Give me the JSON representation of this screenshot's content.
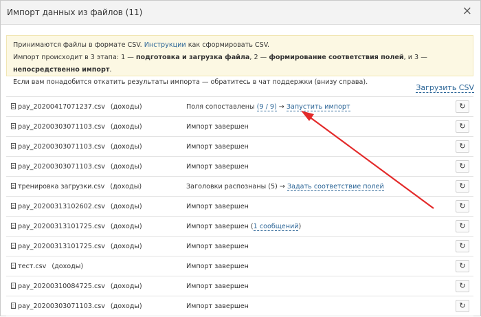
{
  "dialog": {
    "title": "Импорт данных из файлов (11)",
    "close": "×"
  },
  "info": {
    "line1_before": "Принимаются файлы в формате CSV.",
    "line1_link": "Инструкции",
    "line1_after": "как сформировать CSV.",
    "line2_a": "Импорт происходит в 3 этапа: 1 —",
    "line2_b": "подготовка и загрузка файла",
    "line2_c": ", 2 —",
    "line2_d": "формирование соответствия полей",
    "line2_e": ", и 3 —",
    "line2_f": "непосредственно импорт",
    "line2_g": ".",
    "line3": "Если вам понадобится откатить результаты импорта — обратитесь в чат поддержки (внизу справа)."
  },
  "upload_label": "Загрузить CSV",
  "refresh_icon": "refresh-icon",
  "accent_color": "#2a6496",
  "arrow_color": "#e32a2a",
  "rows": [
    {
      "file": "pay_20200417071237.csv",
      "type": "(доходы)",
      "status_text": "Поля сопоставлены",
      "status_link1": "(9 / 9)",
      "status_sep": "→",
      "status_link2": "Запустить импорт",
      "status_after": ""
    },
    {
      "file": "pay_20200303071103.csv",
      "type": "(доходы)",
      "status_text": "Импорт завершен",
      "status_link1": "",
      "status_sep": "",
      "status_link2": "",
      "status_after": ""
    },
    {
      "file": "pay_20200303071103.csv",
      "type": "(доходы)",
      "status_text": "Импорт завершен",
      "status_link1": "",
      "status_sep": "",
      "status_link2": "",
      "status_after": ""
    },
    {
      "file": "pay_20200303071103.csv",
      "type": "(доходы)",
      "status_text": "Импорт завершен",
      "status_link1": "",
      "status_sep": "",
      "status_link2": "",
      "status_after": ""
    },
    {
      "file": "тренировка загрузки.csv",
      "type": "(доходы)",
      "status_text": "Заголовки распознаны (5)",
      "status_link1": "",
      "status_sep": "→",
      "status_link2": "Задать соответствие полей",
      "status_after": ""
    },
    {
      "file": "pay_20200313102602.csv",
      "type": "(доходы)",
      "status_text": "Импорт завершен",
      "status_link1": "",
      "status_sep": "",
      "status_link2": "",
      "status_after": ""
    },
    {
      "file": "pay_20200313101725.csv",
      "type": "(доходы)",
      "status_text": "Импорт завершен (",
      "status_link1": "",
      "status_sep": "",
      "status_link2": "1 сообщений",
      "status_after": ")"
    },
    {
      "file": "pay_20200313101725.csv",
      "type": "(доходы)",
      "status_text": "Импорт завершен",
      "status_link1": "",
      "status_sep": "",
      "status_link2": "",
      "status_after": ""
    },
    {
      "file": "тест.csv",
      "type": "(доходы)",
      "status_text": "Импорт завершен",
      "status_link1": "",
      "status_sep": "",
      "status_link2": "",
      "status_after": ""
    },
    {
      "file": "pay_20200310084725.csv",
      "type": "(доходы)",
      "status_text": "Импорт завершен",
      "status_link1": "",
      "status_sep": "",
      "status_link2": "",
      "status_after": ""
    },
    {
      "file": "pay_20200303071103.csv",
      "type": "(доходы)",
      "status_text": "Импорт завершен",
      "status_link1": "",
      "status_sep": "",
      "status_link2": "",
      "status_after": ""
    }
  ]
}
